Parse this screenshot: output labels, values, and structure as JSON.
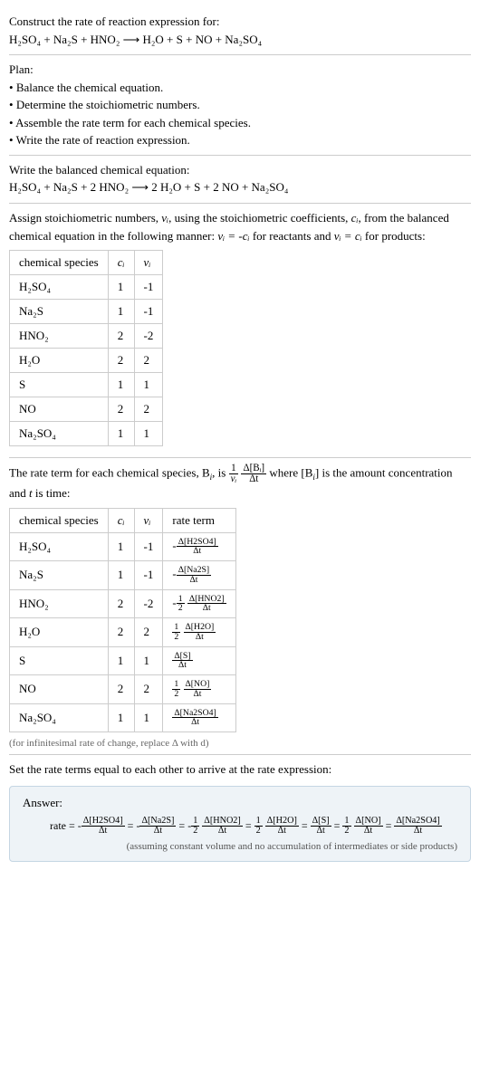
{
  "title": "Construct the rate of reaction expression for:",
  "unbalanced": "H₂SO₄ + Na₂S + HNO₂  ⟶  H₂O + S + NO + Na₂SO₄",
  "planLabel": "Plan:",
  "plan": [
    "Balance the chemical equation.",
    "Determine the stoichiometric numbers.",
    "Assemble the rate term for each chemical species.",
    "Write the rate of reaction expression."
  ],
  "balancedLabel": "Write the balanced chemical equation:",
  "balanced": "H₂SO₄ + Na₂S + 2 HNO₂  ⟶  2 H₂O + S + 2 NO + Na₂SO₄",
  "stoichIntro1": "Assign stoichiometric numbers, ",
  "stoichIntro2": ", using the stoichiometric coefficients, ",
  "stoichIntro3": ", from the balanced chemical equation in the following manner: ",
  "stoichIntro4": " for reactants and ",
  "stoichIntro5": " for products:",
  "tbl1": {
    "h1": "chemical species",
    "h2": "cᵢ",
    "h3": "νᵢ",
    "rows": [
      {
        "sp": "H₂SO₄",
        "c": "1",
        "v": "-1"
      },
      {
        "sp": "Na₂S",
        "c": "1",
        "v": "-1"
      },
      {
        "sp": "HNO₂",
        "c": "2",
        "v": "-2"
      },
      {
        "sp": "H₂O",
        "c": "2",
        "v": "2"
      },
      {
        "sp": "S",
        "c": "1",
        "v": "1"
      },
      {
        "sp": "NO",
        "c": "2",
        "v": "2"
      },
      {
        "sp": "Na₂SO₄",
        "c": "1",
        "v": "1"
      }
    ]
  },
  "rateIntro1": "The rate term for each chemical species, B",
  "rateIntro2": ", is ",
  "rateIntro3": " where [B",
  "rateIntro4": "] is the amount concentration and ",
  "rateIntro5": " is time:",
  "tbl2": {
    "h1": "chemical species",
    "h2": "cᵢ",
    "h3": "νᵢ",
    "h4": "rate term",
    "rows": [
      {
        "sp": "H₂SO₄",
        "c": "1",
        "v": "-1",
        "neg": "-",
        "coef": "",
        "num": "Δ[H2SO4]",
        "den": "Δt"
      },
      {
        "sp": "Na₂S",
        "c": "1",
        "v": "-1",
        "neg": "-",
        "coef": "",
        "num": "Δ[Na2S]",
        "den": "Δt"
      },
      {
        "sp": "HNO₂",
        "c": "2",
        "v": "-2",
        "neg": "-",
        "coef": "½",
        "num": "Δ[HNO2]",
        "den": "Δt"
      },
      {
        "sp": "H₂O",
        "c": "2",
        "v": "2",
        "neg": "",
        "coef": "½",
        "num": "Δ[H2O]",
        "den": "Δt"
      },
      {
        "sp": "S",
        "c": "1",
        "v": "1",
        "neg": "",
        "coef": "",
        "num": "Δ[S]",
        "den": "Δt"
      },
      {
        "sp": "NO",
        "c": "2",
        "v": "2",
        "neg": "",
        "coef": "½",
        "num": "Δ[NO]",
        "den": "Δt"
      },
      {
        "sp": "Na₂SO₄",
        "c": "1",
        "v": "1",
        "neg": "",
        "coef": "",
        "num": "Δ[Na2SO4]",
        "den": "Δt"
      }
    ]
  },
  "footnote": "(for infinitesimal rate of change, replace Δ with d)",
  "setEqual": "Set the rate terms equal to each other to arrive at the rate expression:",
  "answerLabel": "Answer:",
  "answerLead": "rate = ",
  "ans": [
    {
      "neg": "-",
      "coef": "",
      "num": "Δ[H2SO4]",
      "den": "Δt"
    },
    {
      "neg": "-",
      "coef": "",
      "num": "Δ[Na2S]",
      "den": "Δt"
    },
    {
      "neg": "-",
      "coef": "½",
      "num": "Δ[HNO2]",
      "den": "Δt"
    },
    {
      "neg": "",
      "coef": "½",
      "num": "Δ[H2O]",
      "den": "Δt"
    },
    {
      "neg": "",
      "coef": "",
      "num": "Δ[S]",
      "den": "Δt"
    },
    {
      "neg": "",
      "coef": "½",
      "num": "Δ[NO]",
      "den": "Δt"
    },
    {
      "neg": "",
      "coef": "",
      "num": "Δ[Na2SO4]",
      "den": "Δt"
    }
  ],
  "answerNote": "(assuming constant volume and no accumulation of intermediates or side products)",
  "half_num": "1",
  "half_den": "2",
  "nu_i": "νᵢ",
  "c_i": "cᵢ",
  "t": "t",
  "i": "i",
  "eqReactants": "νᵢ = -cᵢ",
  "eqProducts": "νᵢ = cᵢ",
  "dBi_num": "Δ[Bᵢ]",
  "dBi_den": "Δt",
  "one_over_nu_num": "1",
  "one_over_nu_den": "νᵢ",
  "eq": " = "
}
